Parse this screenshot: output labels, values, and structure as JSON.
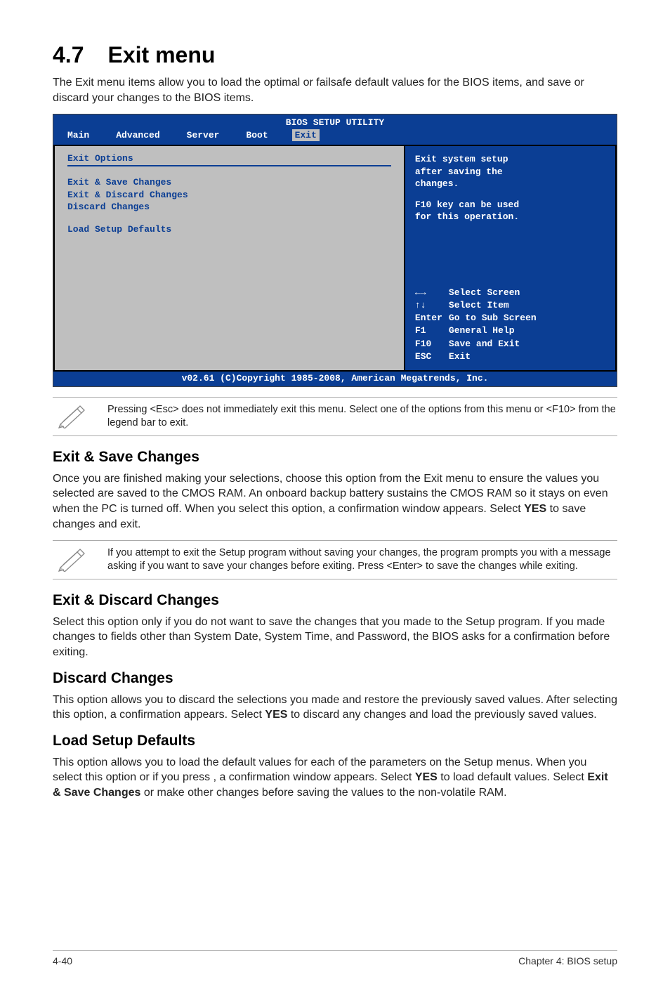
{
  "title_num": "4.7",
  "title_text": "Exit menu",
  "intro": "The Exit menu items allow you to load the optimal or failsafe default values for the BIOS items, and save or discard your changes to the BIOS items.",
  "bios": {
    "header": "BIOS SETUP UTILITY",
    "tabs": {
      "t0": "Main",
      "t1": "Advanced",
      "t2": "Server",
      "t3": "Boot",
      "t4": "Exit"
    },
    "left": {
      "section_title": "Exit Options",
      "i0": "Exit & Save Changes",
      "i1": "Exit & Discard Changes",
      "i2": "Discard Changes",
      "i3": "Load Setup Defaults"
    },
    "right": {
      "desc_l1": "Exit system setup",
      "desc_l2": "after saving the",
      "desc_l3": "changes.",
      "desc_l4": "F10 key can be used",
      "desc_l5": "for this operation.",
      "k0_key": "←→",
      "k0_txt": "Select Screen",
      "k1_key": "↑↓",
      "k1_txt": "Select Item",
      "k2_key": "Enter",
      "k2_txt": "Go to Sub Screen",
      "k3_key": "F1",
      "k3_txt": "General Help",
      "k4_key": "F10",
      "k4_txt": "Save and Exit",
      "k5_key": "ESC",
      "k5_txt": "Exit"
    },
    "footer": "v02.61 (C)Copyright 1985-2008, American Megatrends, Inc."
  },
  "note1": "Pressing <Esc> does not immediately exit this menu. Select one of the options from this menu or <F10> from the legend bar to exit.",
  "sec1": {
    "heading": "Exit & Save Changes",
    "body_html": "Once you are finished making your selections, choose this option from the Exit menu to ensure the values you selected are saved to the CMOS RAM. An onboard backup battery sustains the CMOS RAM so it stays on even when the PC is turned off. When you select this option, a confirmation window appears. Select <b>YES</b> to save changes and exit."
  },
  "note2": "If you attempt to exit the Setup program without saving your changes, the program prompts you with a message asking if you want to save your changes before exiting. Press <Enter> to save the changes while exiting.",
  "sec2": {
    "heading": "Exit & Discard Changes",
    "body": "Select this option only if you do not want to save the changes that you made to the Setup program. If you made changes to fields other than System Date, System Time, and Password, the BIOS asks for a confirmation before exiting."
  },
  "sec3": {
    "heading": "Discard Changes",
    "body_html": "This option allows you to discard the selections you made and restore the previously saved values. After selecting this option, a confirmation appears. Select <b>YES</b> to discard any changes and load the previously saved values."
  },
  "sec4": {
    "heading": "Load Setup Defaults",
    "body_html": "This option allows you to load the default values for each of the parameters on the Setup menus. When you select this option or if you press <F5>, a confirmation window appears. Select <b>YES</b> to load default values. Select <b>Exit & Save Changes</b> or make other changes before saving the values to the non-volatile RAM."
  },
  "pagefoot": {
    "left": "4-40",
    "right": "Chapter 4: BIOS setup"
  }
}
